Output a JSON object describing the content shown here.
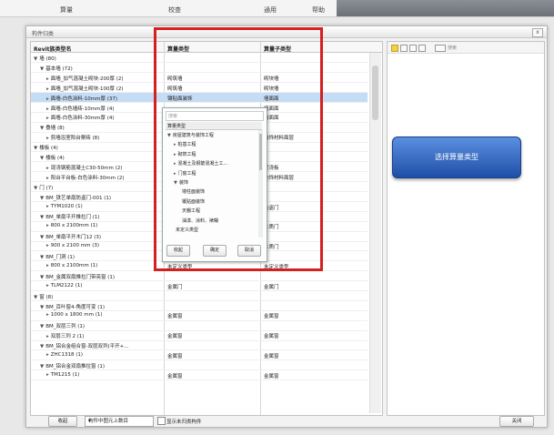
{
  "topbar": {
    "tabs": [
      "算量",
      "校查",
      "通用",
      "帮助"
    ]
  },
  "dialog": {
    "title": "构件归类",
    "close_label": "x"
  },
  "table": {
    "headers": [
      "Revit族类型名",
      "算量类型",
      "算量子类型"
    ],
    "rows": [
      {
        "indent": 0,
        "tri": "▼",
        "name": "墙 (80)",
        "type": "",
        "sub": ""
      },
      {
        "indent": 1,
        "tri": "▼",
        "name": "基本墙 (72)",
        "type": "",
        "sub": ""
      },
      {
        "indent": 2,
        "tri": "▸",
        "name": "面墙_加气混凝土砌块-200厚 (2)",
        "type": "砌筑墙",
        "sub": "砌块墙"
      },
      {
        "indent": 2,
        "tri": "▸",
        "name": "面墙_加气混凝土砌块-100厚 (2)",
        "type": "砌筑墙",
        "sub": "砌块墙"
      },
      {
        "indent": 2,
        "tri": "▸",
        "name": "面墙-白色涂料-10mm厚 (37)",
        "type": "镶贴面装饰",
        "sub": "墙面面",
        "selected": true
      },
      {
        "indent": 2,
        "tri": "▸",
        "name": "面墙-白色墙砖-10mm厚 (4)",
        "type": "",
        "sub": "墙面面"
      },
      {
        "indent": 2,
        "tri": "▸",
        "name": "面墙-白色涂料-30mm厚 (4)",
        "type": "",
        "sub": "墙面面"
      },
      {
        "indent": 1,
        "tri": "▼",
        "name": "叠墙 (8)",
        "type": "",
        "sub": ""
      },
      {
        "indent": 2,
        "tri": "▸",
        "name": "剪墙浴室阳台栗砖 (8)",
        "type": "",
        "sub": "墙饰材料面层"
      },
      {
        "indent": 0,
        "tri": "▼",
        "name": "楼板 (4)",
        "type": "",
        "sub": ""
      },
      {
        "indent": 1,
        "tri": "▼",
        "name": "楼板 (4)",
        "type": "",
        "sub": ""
      },
      {
        "indent": 2,
        "tri": "▸",
        "name": "现浇钢筋混凝土C30-50mm (2)",
        "type": "",
        "sub": "现浇板"
      },
      {
        "indent": 2,
        "tri": "▸",
        "name": "阳台平台板-白色涂料-30mm (2)",
        "type": "",
        "sub": "地饰材料面层"
      },
      {
        "indent": 0,
        "tri": "▼",
        "name": "门 (7)",
        "type": "",
        "sub": ""
      },
      {
        "indent": 1,
        "tri": "▼",
        "name": "BM_铁艺单扇防盗门-001 (1)",
        "type": "",
        "sub": ""
      },
      {
        "indent": 2,
        "tri": "▸",
        "name": "TYM1020 (1)",
        "type": "",
        "sub": "防盗门"
      },
      {
        "indent": 1,
        "tri": "▼",
        "name": "BM_单扇平开推拉门 (1)",
        "type": "",
        "sub": ""
      },
      {
        "indent": 2,
        "tri": "▸",
        "name": "800 x 2100mm (1)",
        "type": "",
        "sub": "木质门"
      },
      {
        "indent": 1,
        "tri": "▼",
        "name": "BM_单扇平开木门12 (3)",
        "type": "",
        "sub": ""
      },
      {
        "indent": 2,
        "tri": "▸",
        "name": "900 x 2100 mm (3)",
        "type": "木门",
        "sub": "木质门"
      },
      {
        "indent": 1,
        "tri": "▼",
        "name": "BM_门洞 (1)",
        "type": "",
        "sub": ""
      },
      {
        "indent": 2,
        "tri": "▸",
        "name": "800 x 2100mm (1)",
        "type": "未定义类型",
        "sub": "未定义类型"
      },
      {
        "indent": 1,
        "tri": "▼",
        "name": "BM_金属双扇推拉门带亮窗 (1)",
        "type": "",
        "sub": ""
      },
      {
        "indent": 2,
        "tri": "▸",
        "name": "TLM2122 (1)",
        "type": "金属门",
        "sub": "金属门"
      },
      {
        "indent": 0,
        "tri": "▼",
        "name": "窗 (8)",
        "type": "",
        "sub": ""
      },
      {
        "indent": 1,
        "tri": "▼",
        "name": "BM_百叶窗4-角度可变 (1)",
        "type": "",
        "sub": ""
      },
      {
        "indent": 2,
        "tri": "▸",
        "name": "1000 x 1800 mm (1)",
        "type": "金属窗",
        "sub": "金属窗"
      },
      {
        "indent": 1,
        "tri": "▼",
        "name": "BM_双层三列 (1)",
        "type": "",
        "sub": ""
      },
      {
        "indent": 2,
        "tri": "▸",
        "name": "双层三列 2 (1)",
        "type": "金属窗",
        "sub": "金属窗"
      },
      {
        "indent": 1,
        "tri": "▼",
        "name": "BM_铝合金组合窗-双层双列(平开+...",
        "type": "",
        "sub": ""
      },
      {
        "indent": 2,
        "tri": "▸",
        "name": "ZHC1318 (1)",
        "type": "金属窗",
        "sub": "金属窗"
      },
      {
        "indent": 1,
        "tri": "▼",
        "name": "BM_铝合金双扇推拉窗 (1)",
        "type": "",
        "sub": ""
      },
      {
        "indent": 2,
        "tri": "▸",
        "name": "TM1215 (1)",
        "type": "金属窗",
        "sub": "金属窗"
      }
    ]
  },
  "popup": {
    "search_placeholder": "搜索",
    "header": "算量类型",
    "items": [
      {
        "indent": 0,
        "tri": "▼",
        "label": "房屋建筑与装饰工程"
      },
      {
        "indent": 1,
        "tri": "▸",
        "label": "桩基工程"
      },
      {
        "indent": 1,
        "tri": "▸",
        "label": "砌筑工程"
      },
      {
        "indent": 1,
        "tri": "▸",
        "label": "混凝土及钢筋混凝土工..."
      },
      {
        "indent": 1,
        "tri": "▸",
        "label": "门窗工程"
      },
      {
        "indent": 1,
        "tri": "▼",
        "label": "装饰"
      },
      {
        "indent": 2,
        "tri": "",
        "label": "墙柱面装饰"
      },
      {
        "indent": 2,
        "tri": "",
        "label": "镶贴面装饰"
      },
      {
        "indent": 2,
        "tri": "",
        "label": "天棚工程"
      },
      {
        "indent": 2,
        "tri": "",
        "label": "油漆、涂料、裱糊"
      },
      {
        "indent": 1,
        "tri": "",
        "label": "未定义类型"
      }
    ],
    "buttons": {
      "collapse": "收起",
      "ok": "确定",
      "cancel": "取消"
    }
  },
  "right_panel": {
    "search_placeholder": "搜索"
  },
  "callout": {
    "text": "选择算量类型"
  },
  "footer": {
    "collapse_label": "收起",
    "select_value": "构件中图元上数目",
    "select_arrow": "▾",
    "checkbox_label": "显示未归类构件",
    "close_label": "关闭"
  },
  "colors": {
    "highlight_box": "#d42020",
    "callout_bg": "#2f64c4",
    "selected_row": "#c5dcf5"
  }
}
